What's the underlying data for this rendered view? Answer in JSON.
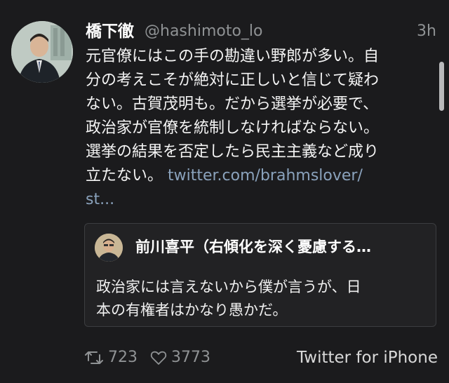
{
  "tweet": {
    "author": {
      "display_name": "橋下徹",
      "handle": "@hashimoto_lo",
      "avatar_icon": "profile-photo"
    },
    "time": "3h",
    "text_lines": [
      "元官僚にはこの手の勘違い野郎が多い。自",
      "分の考えこそが絶対に正しいと信じて疑わ",
      "ない。古賀茂明も。だから選挙が必要で、",
      "政治家が官僚を統制しなければならない。",
      "選挙の結果を否定したら民主主義など成り",
      "立たない。"
    ],
    "link_inline": "twitter.com/brahmslover/",
    "link_continued": "st...",
    "quoted": {
      "name": "前川喜平（右傾化を深く憂慮する…",
      "text_lines": [
        "政治家には言えないから僕が言うが、日",
        "本の有権者はかなり愚かだ。"
      ]
    },
    "actions": {
      "retweet_icon": "retweet-icon",
      "retweet_count": "723",
      "like_icon": "heart-icon",
      "like_count": "3773"
    },
    "source": "Twitter for iPhone"
  },
  "colors": {
    "background": "#1b1b1d",
    "link": "#8aa2bc",
    "muted": "#8f9294",
    "quote_border": "#3c3d40"
  }
}
